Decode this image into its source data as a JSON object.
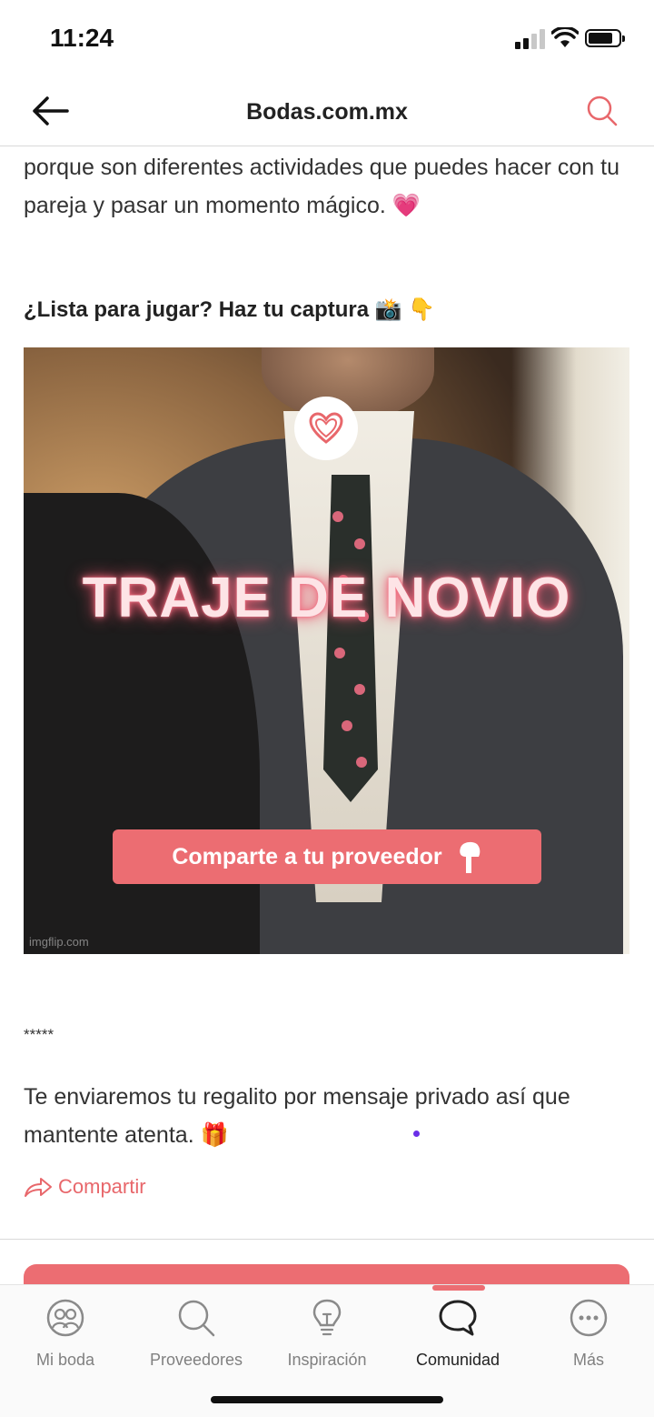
{
  "status_bar": {
    "time": "11:24"
  },
  "header": {
    "title": "Bodas.com.mx"
  },
  "article": {
    "intro_text": "porque son diferentes actividades que puedes hacer con tu pareja y pasar un momento mágico. 💗",
    "prompt_heading": "¿Lista para jugar? Haz tu captura 📸 👇",
    "image": {
      "title": "TRAJE DE NOVIO",
      "cta_label": "Comparte a tu proveedor",
      "watermark": "imgflip.com"
    },
    "separator": "*****",
    "closing_text": "Te enviaremos tu regalito por mensaje privado así que mantente atenta. 🎁",
    "share_label": "Compartir"
  },
  "tab_bar": {
    "active": "Comunidad",
    "items": [
      {
        "label": "Mi boda",
        "icon": "couple-icon"
      },
      {
        "label": "Proveedores",
        "icon": "search-icon"
      },
      {
        "label": "Inspiración",
        "icon": "lightbulb-icon"
      },
      {
        "label": "Comunidad",
        "icon": "chat-bubble-icon"
      },
      {
        "label": "Más",
        "icon": "more-dots-icon"
      }
    ]
  },
  "colors": {
    "accent": "#ec6d72",
    "text": "#222222",
    "inactive": "#808080"
  }
}
